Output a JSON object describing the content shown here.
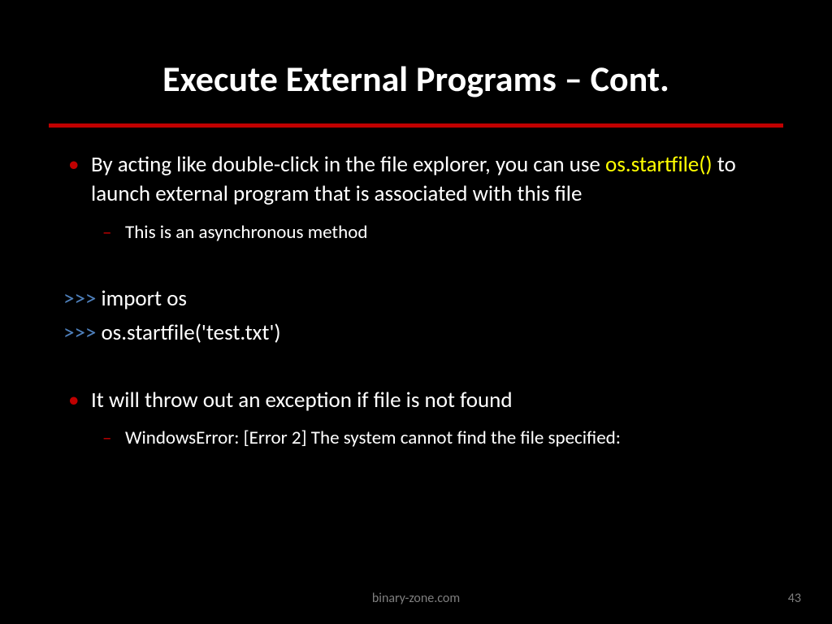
{
  "title": "Execute External Programs – Cont.",
  "bullets": {
    "first": {
      "pre": "By acting like double-click in the file explorer, you can use ",
      "highlight": "os.startfile()",
      "post": " to launch external program that is associated with this file",
      "sub": "This is an asynchronous method"
    },
    "code": {
      "prompt1": ">>>",
      "line1": " import os",
      "prompt2": ">>>",
      "line2": " os.startfile('test.txt')"
    },
    "second": {
      "text": "It will throw out an exception if file is not found",
      "sub": "WindowsError: [Error 2] The system cannot find the file specified:"
    }
  },
  "footer": {
    "site": "binary-zone.com",
    "page": "43"
  }
}
